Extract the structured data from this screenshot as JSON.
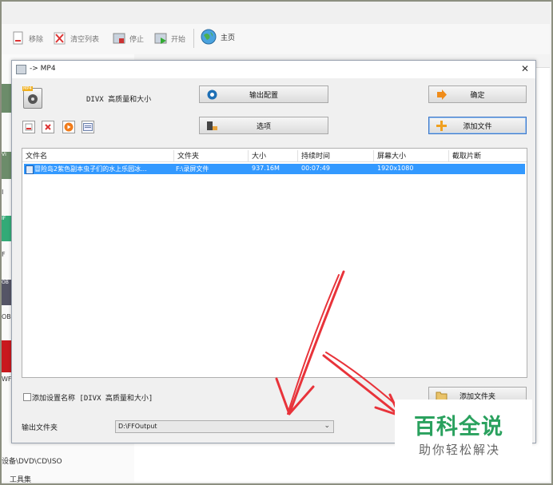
{
  "toolbar": {
    "remove": "移除",
    "clear_list": "清空列表",
    "stop": "停止",
    "start": "开始",
    "home": "主页"
  },
  "background": {
    "left_items": [
      "设备\\DVD\\CD\\ISO",
      "工具集"
    ],
    "left_strip_labels": [
      "VI",
      "I",
      "IF",
      "F",
      "OB",
      "OB",
      "WF"
    ]
  },
  "dialog": {
    "title": "-> MP4",
    "preset_badge": "MP4",
    "preset_name": "DIVX 高质量和大小",
    "buttons": {
      "output_config": "输出配置",
      "options": "选项",
      "ok": "确定",
      "add_file": "添加文件",
      "add_folder": "添加文件夹"
    },
    "file_list": {
      "columns": [
        "文件名",
        "文件夹",
        "大小",
        "持续时间",
        "屏幕大小",
        "截取片断"
      ],
      "rows": [
        {
          "name": "冒险岛2紫色副本虫子们的水上乐园冰...",
          "folder": "F:\\录屏文件",
          "size": "937.16M",
          "duration": "00:07:49",
          "resolution": "1920x1080",
          "clip": ""
        }
      ]
    },
    "add_preset_name_label": "添加设置名称 [DIVX 高质量和大小]",
    "output_folder_label": "输出文件夹",
    "output_folder_value": "D:\\FFOutput"
  },
  "watermark": {
    "brand": "百科全说",
    "tagline": "助你轻松解决"
  },
  "colors": {
    "selection": "#3399ff",
    "arrow": "#e8333a",
    "brand_green": "#2aa15e"
  }
}
